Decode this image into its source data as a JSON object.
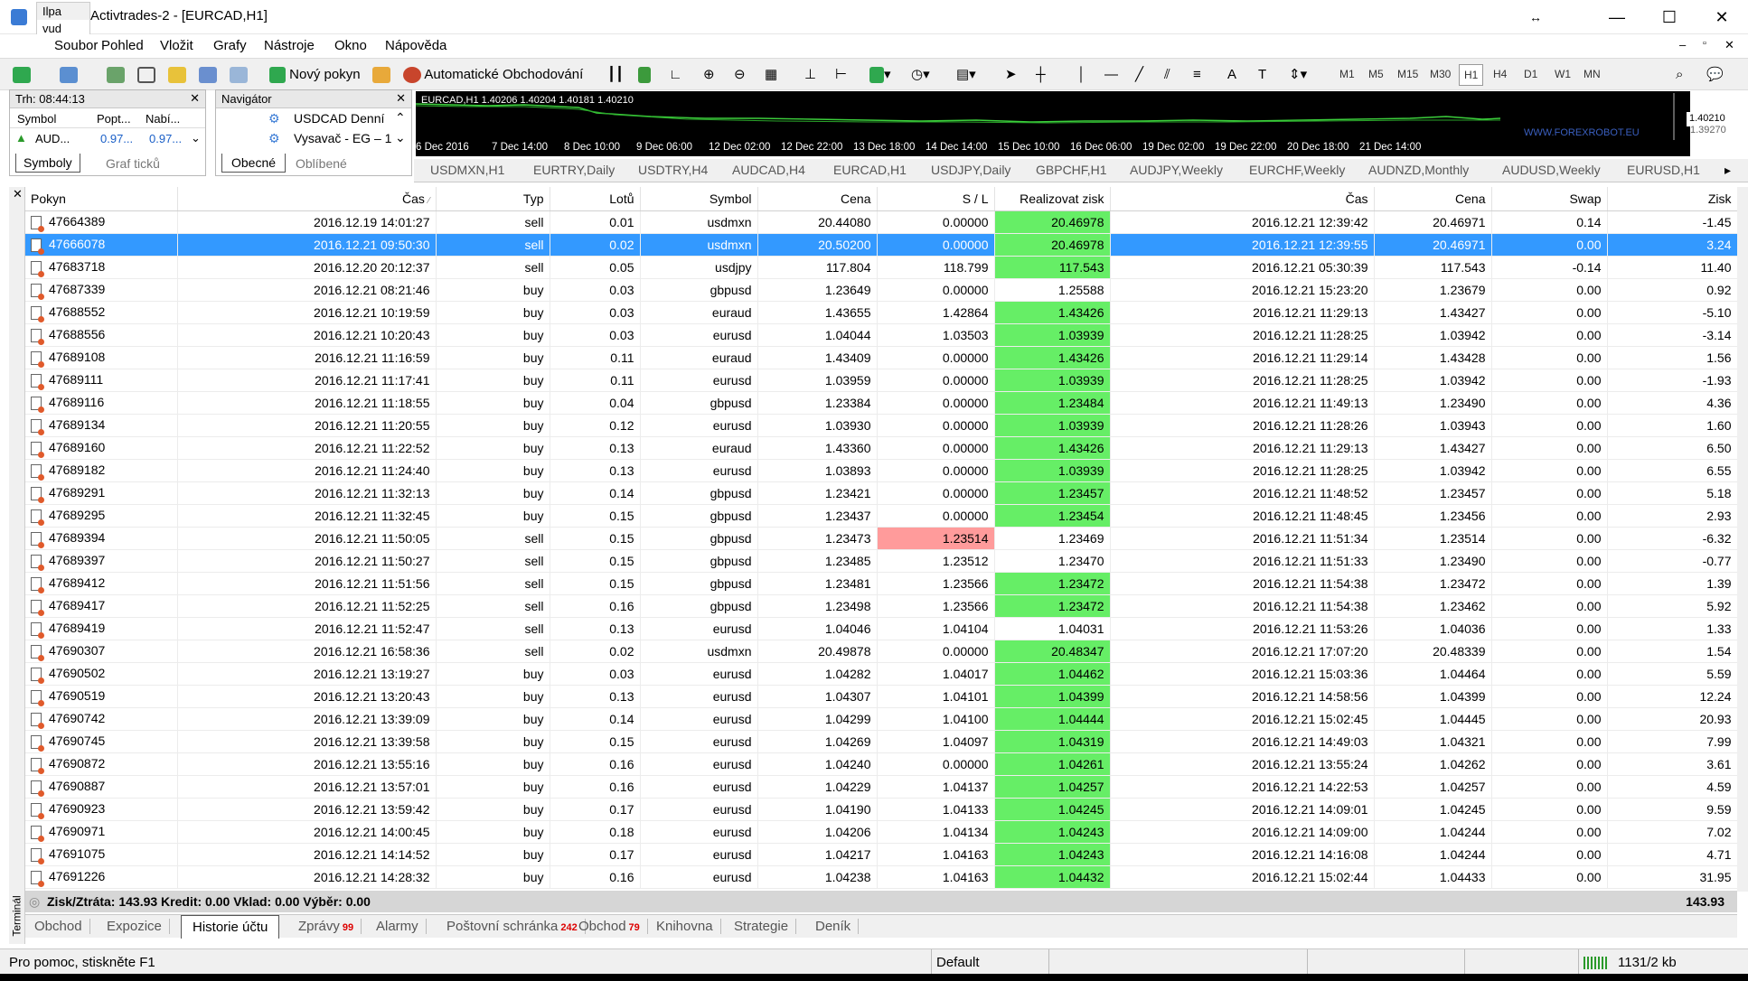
{
  "window": {
    "title": "Activtrades-2 - [EURCAD,H1]",
    "popup_line1": "Ilpa",
    "popup_line2": "vud",
    "btn_restore": "↔",
    "btn_min": "—",
    "btn_max": "☐",
    "btn_close": "✕"
  },
  "menu": [
    "Soubor",
    "Pohled",
    "Vložit",
    "Grafy",
    "Nástroje",
    "Okno",
    "Nápověda"
  ],
  "toolbar": {
    "new_order": "Nový pokyn",
    "auto_trading": "Automatické Obchodování",
    "timeframes": [
      "M1",
      "M5",
      "M15",
      "M30",
      "H1",
      "H4",
      "D1",
      "W1",
      "MN"
    ],
    "active_timeframe": "H1"
  },
  "market_watch": {
    "header": "Trh: 08:44:13",
    "col_symbol": "Symbol",
    "col_bid": "Popt...",
    "col_ask": "Nabí...",
    "row_symbol": "AUD...",
    "row_bid": "0.97...",
    "row_ask": "0.97...",
    "tab1": "Symboly",
    "tab2": "Graf ticků"
  },
  "navigator": {
    "header": "Navigátor",
    "item1": "USDCAD Denní",
    "item2": "Vysavač - EG – 1",
    "tab1": "Obecné",
    "tab2": "Oblíbené"
  },
  "chart": {
    "info": "EURCAD,H1  1.40206  1.40204  1.40181  1.40210",
    "price1": "1.40210",
    "price2": "1.39270",
    "watermark": "WWW.FOREXROBOT.EU",
    "dates": [
      "6 Dec 2016",
      "7 Dec 14:00",
      "8 Dec 10:00",
      "9 Dec 06:00",
      "12 Dec 02:00",
      "12 Dec 22:00",
      "13 Dec 18:00",
      "14 Dec 14:00",
      "15 Dec 10:00",
      "16 Dec 06:00",
      "19 Dec 02:00",
      "19 Dec 22:00",
      "20 Dec 18:00",
      "21 Dec 14:00"
    ]
  },
  "chart_tabs": [
    "USDMXN,H1",
    "EURTRY,Daily",
    "USDTRY,H4",
    "AUDCAD,H4",
    "EURCAD,H1",
    "USDJPY,Daily",
    "GBPCHF,H1",
    "AUDJPY,Weekly",
    "EURCHF,Weekly",
    "AUDNZD,Monthly",
    "AUDUSD,Weekly",
    "EURUSD,H1"
  ],
  "table": {
    "headers": [
      "Pokyn",
      "Čas",
      "Typ",
      "Lotů",
      "Symbol",
      "Cena",
      "S / L",
      "Realizovat zisk",
      "Čas",
      "Cena",
      "Swap",
      "Zisk"
    ],
    "rows": [
      [
        "47664389",
        "2016.12.19 14:01:27",
        "sell",
        "0.01",
        "usdmxn",
        "20.44080",
        "0.00000",
        "20.46978",
        "2016.12.21 12:39:42",
        "20.46971",
        "0.14",
        "-1.45"
      ],
      [
        "47666078",
        "2016.12.21 09:50:30",
        "sell",
        "0.02",
        "usdmxn",
        "20.50200",
        "0.00000",
        "20.46978",
        "2016.12.21 12:39:55",
        "20.46971",
        "0.00",
        "3.24"
      ],
      [
        "47683718",
        "2016.12.20 20:12:37",
        "sell",
        "0.05",
        "usdjpy",
        "117.804",
        "118.799",
        "117.543",
        "2016.12.21 05:30:39",
        "117.543",
        "-0.14",
        "11.40"
      ],
      [
        "47687339",
        "2016.12.21 08:21:46",
        "buy",
        "0.03",
        "gbpusd",
        "1.23649",
        "0.00000",
        "1.25588",
        "2016.12.21 15:23:20",
        "1.23679",
        "0.00",
        "0.92"
      ],
      [
        "47688552",
        "2016.12.21 10:19:59",
        "buy",
        "0.03",
        "euraud",
        "1.43655",
        "1.42864",
        "1.43426",
        "2016.12.21 11:29:13",
        "1.43427",
        "0.00",
        "-5.10"
      ],
      [
        "47688556",
        "2016.12.21 10:20:43",
        "buy",
        "0.03",
        "eurusd",
        "1.04044",
        "1.03503",
        "1.03939",
        "2016.12.21 11:28:25",
        "1.03942",
        "0.00",
        "-3.14"
      ],
      [
        "47689108",
        "2016.12.21 11:16:59",
        "buy",
        "0.11",
        "euraud",
        "1.43409",
        "0.00000",
        "1.43426",
        "2016.12.21 11:29:14",
        "1.43428",
        "0.00",
        "1.56"
      ],
      [
        "47689111",
        "2016.12.21 11:17:41",
        "buy",
        "0.11",
        "eurusd",
        "1.03959",
        "0.00000",
        "1.03939",
        "2016.12.21 11:28:25",
        "1.03942",
        "0.00",
        "-1.93"
      ],
      [
        "47689116",
        "2016.12.21 11:18:55",
        "buy",
        "0.04",
        "gbpusd",
        "1.23384",
        "0.00000",
        "1.23484",
        "2016.12.21 11:49:13",
        "1.23490",
        "0.00",
        "4.36"
      ],
      [
        "47689134",
        "2016.12.21 11:20:55",
        "buy",
        "0.12",
        "eurusd",
        "1.03930",
        "0.00000",
        "1.03939",
        "2016.12.21 11:28:26",
        "1.03943",
        "0.00",
        "1.60"
      ],
      [
        "47689160",
        "2016.12.21 11:22:52",
        "buy",
        "0.13",
        "euraud",
        "1.43360",
        "0.00000",
        "1.43426",
        "2016.12.21 11:29:13",
        "1.43427",
        "0.00",
        "6.50"
      ],
      [
        "47689182",
        "2016.12.21 11:24:40",
        "buy",
        "0.13",
        "eurusd",
        "1.03893",
        "0.00000",
        "1.03939",
        "2016.12.21 11:28:25",
        "1.03942",
        "0.00",
        "6.55"
      ],
      [
        "47689291",
        "2016.12.21 11:32:13",
        "buy",
        "0.14",
        "gbpusd",
        "1.23421",
        "0.00000",
        "1.23457",
        "2016.12.21 11:48:52",
        "1.23457",
        "0.00",
        "5.18"
      ],
      [
        "47689295",
        "2016.12.21 11:32:45",
        "buy",
        "0.15",
        "gbpusd",
        "1.23437",
        "0.00000",
        "1.23454",
        "2016.12.21 11:48:45",
        "1.23456",
        "0.00",
        "2.93"
      ],
      [
        "47689394",
        "2016.12.21 11:50:05",
        "sell",
        "0.15",
        "gbpusd",
        "1.23473",
        "1.23514",
        "1.23469",
        "2016.12.21 11:51:34",
        "1.23514",
        "0.00",
        "-6.32"
      ],
      [
        "47689397",
        "2016.12.21 11:50:27",
        "sell",
        "0.15",
        "gbpusd",
        "1.23485",
        "1.23512",
        "1.23470",
        "2016.12.21 11:51:33",
        "1.23490",
        "0.00",
        "-0.77"
      ],
      [
        "47689412",
        "2016.12.21 11:51:56",
        "sell",
        "0.15",
        "gbpusd",
        "1.23481",
        "1.23566",
        "1.23472",
        "2016.12.21 11:54:38",
        "1.23472",
        "0.00",
        "1.39"
      ],
      [
        "47689417",
        "2016.12.21 11:52:25",
        "sell",
        "0.16",
        "gbpusd",
        "1.23498",
        "1.23566",
        "1.23472",
        "2016.12.21 11:54:38",
        "1.23462",
        "0.00",
        "5.92"
      ],
      [
        "47689419",
        "2016.12.21 11:52:47",
        "sell",
        "0.13",
        "eurusd",
        "1.04046",
        "1.04104",
        "1.04031",
        "2016.12.21 11:53:26",
        "1.04036",
        "0.00",
        "1.33"
      ],
      [
        "47690307",
        "2016.12.21 16:58:36",
        "sell",
        "0.02",
        "usdmxn",
        "20.49878",
        "0.00000",
        "20.48347",
        "2016.12.21 17:07:20",
        "20.48339",
        "0.00",
        "1.54"
      ],
      [
        "47690502",
        "2016.12.21 13:19:27",
        "buy",
        "0.03",
        "eurusd",
        "1.04282",
        "1.04017",
        "1.04462",
        "2016.12.21 15:03:36",
        "1.04464",
        "0.00",
        "5.59"
      ],
      [
        "47690519",
        "2016.12.21 13:20:43",
        "buy",
        "0.13",
        "eurusd",
        "1.04307",
        "1.04101",
        "1.04399",
        "2016.12.21 14:58:56",
        "1.04399",
        "0.00",
        "12.24"
      ],
      [
        "47690742",
        "2016.12.21 13:39:09",
        "buy",
        "0.14",
        "eurusd",
        "1.04299",
        "1.04100",
        "1.04444",
        "2016.12.21 15:02:45",
        "1.04445",
        "0.00",
        "20.93"
      ],
      [
        "47690745",
        "2016.12.21 13:39:58",
        "buy",
        "0.15",
        "eurusd",
        "1.04269",
        "1.04097",
        "1.04319",
        "2016.12.21 14:49:03",
        "1.04321",
        "0.00",
        "7.99"
      ],
      [
        "47690872",
        "2016.12.21 13:55:16",
        "buy",
        "0.16",
        "eurusd",
        "1.04240",
        "0.00000",
        "1.04261",
        "2016.12.21 13:55:24",
        "1.04262",
        "0.00",
        "3.61"
      ],
      [
        "47690887",
        "2016.12.21 13:57:01",
        "buy",
        "0.16",
        "eurusd",
        "1.04229",
        "1.04137",
        "1.04257",
        "2016.12.21 14:22:53",
        "1.04257",
        "0.00",
        "4.59"
      ],
      [
        "47690923",
        "2016.12.21 13:59:42",
        "buy",
        "0.17",
        "eurusd",
        "1.04190",
        "1.04133",
        "1.04245",
        "2016.12.21 14:09:01",
        "1.04245",
        "0.00",
        "9.59"
      ],
      [
        "47690971",
        "2016.12.21 14:00:45",
        "buy",
        "0.18",
        "eurusd",
        "1.04206",
        "1.04134",
        "1.04243",
        "2016.12.21 14:09:00",
        "1.04244",
        "0.00",
        "7.02"
      ],
      [
        "47691075",
        "2016.12.21 14:14:52",
        "buy",
        "0.17",
        "eurusd",
        "1.04217",
        "1.04163",
        "1.04243",
        "2016.12.21 14:16:08",
        "1.04244",
        "0.00",
        "4.71"
      ],
      [
        "47691226",
        "2016.12.21 14:28:32",
        "buy",
        "0.16",
        "eurusd",
        "1.04238",
        "1.04163",
        "1.04432",
        "2016.12.21 15:02:44",
        "1.04433",
        "0.00",
        "31.95"
      ]
    ],
    "selected_row": 1,
    "tp_green_rows": [
      0,
      1,
      2,
      4,
      5,
      6,
      7,
      8,
      9,
      10,
      11,
      12,
      13,
      16,
      17,
      19,
      20,
      21,
      22,
      23,
      24,
      25,
      26,
      27,
      28,
      29
    ],
    "sl_red_rows": [
      14
    ]
  },
  "summary": {
    "text": "Zisk/Ztráta: 143.93  Kredit: 0.00  Vklad: 0.00  Výběr: 0.00",
    "total": "143.93"
  },
  "bottom_tabs": [
    {
      "label": "Obchod",
      "badge": ""
    },
    {
      "label": "Expozice",
      "badge": ""
    },
    {
      "label": "Historie účtu",
      "badge": ""
    },
    {
      "label": "Zprávy",
      "badge": "99"
    },
    {
      "label": "Alarmy",
      "badge": ""
    },
    {
      "label": "Poštovní schránka",
      "badge": "242"
    },
    {
      "label": "Obchod",
      "badge": "79"
    },
    {
      "label": "Knihovna",
      "badge": ""
    },
    {
      "label": "Strategie",
      "badge": ""
    },
    {
      "label": "Deník",
      "badge": ""
    }
  ],
  "active_bottom_tab": 2,
  "terminal_label": "Terminál",
  "status": {
    "help": "Pro pomoc, stiskněte F1",
    "profile": "Default",
    "traffic": "1131/2 kb"
  },
  "colors": {
    "selected": "#3399ff",
    "tp_green": "#66ee66",
    "sl_red": "#ff9b9b"
  }
}
